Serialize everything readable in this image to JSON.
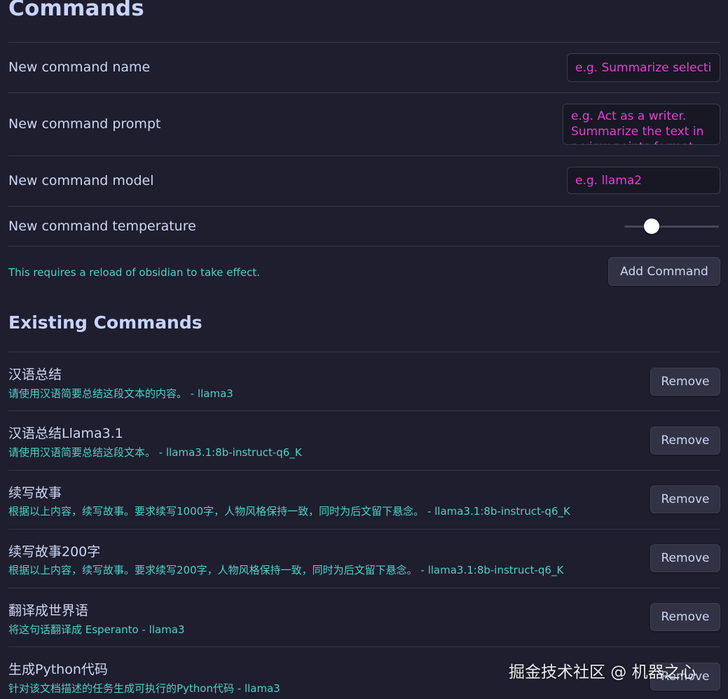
{
  "title": "Commands",
  "new_command": {
    "name_label": "New command name",
    "name_placeholder": "e.g. Summarize selection",
    "prompt_label": "New command prompt",
    "prompt_placeholder": "e.g. Act as a writer. Summarize the text in a view points format.",
    "model_label": "New command model",
    "model_placeholder": "e.g. llama2",
    "temperature_label": "New command temperature",
    "temperature_value": 0.25,
    "reload_note": "This requires a reload of obsidian to take effect.",
    "add_button": "Add Command"
  },
  "existing_title": "Existing Commands",
  "remove_label": "Remove",
  "commands": [
    {
      "name": "汉语总结",
      "desc": "请使用汉语简要总结这段文本的内容。 - llama3"
    },
    {
      "name": "汉语总结Llama3.1",
      "desc": "请使用汉语简要总结这段文本。 - llama3.1:8b-instruct-q6_K"
    },
    {
      "name": "续写故事",
      "desc": "根据以上内容，续写故事。要求续写1000字，人物风格保持一致，同时为后文留下悬念。 - llama3.1:8b-instruct-q6_K"
    },
    {
      "name": "续写故事200字",
      "desc": "根据以上内容，续写故事。要求续写200字，人物风格保持一致，同时为后文留下悬念。 - llama3.1:8b-instruct-q6_K"
    },
    {
      "name": "翻译成世界语",
      "desc": "将这句话翻译成 Esperanto - llama3"
    },
    {
      "name": "生成Python代码",
      "desc": "针对该文档描述的任务生成可执行的Python代码 - llama3"
    }
  ],
  "watermark": "掘金技术社区 @ 机器之心"
}
